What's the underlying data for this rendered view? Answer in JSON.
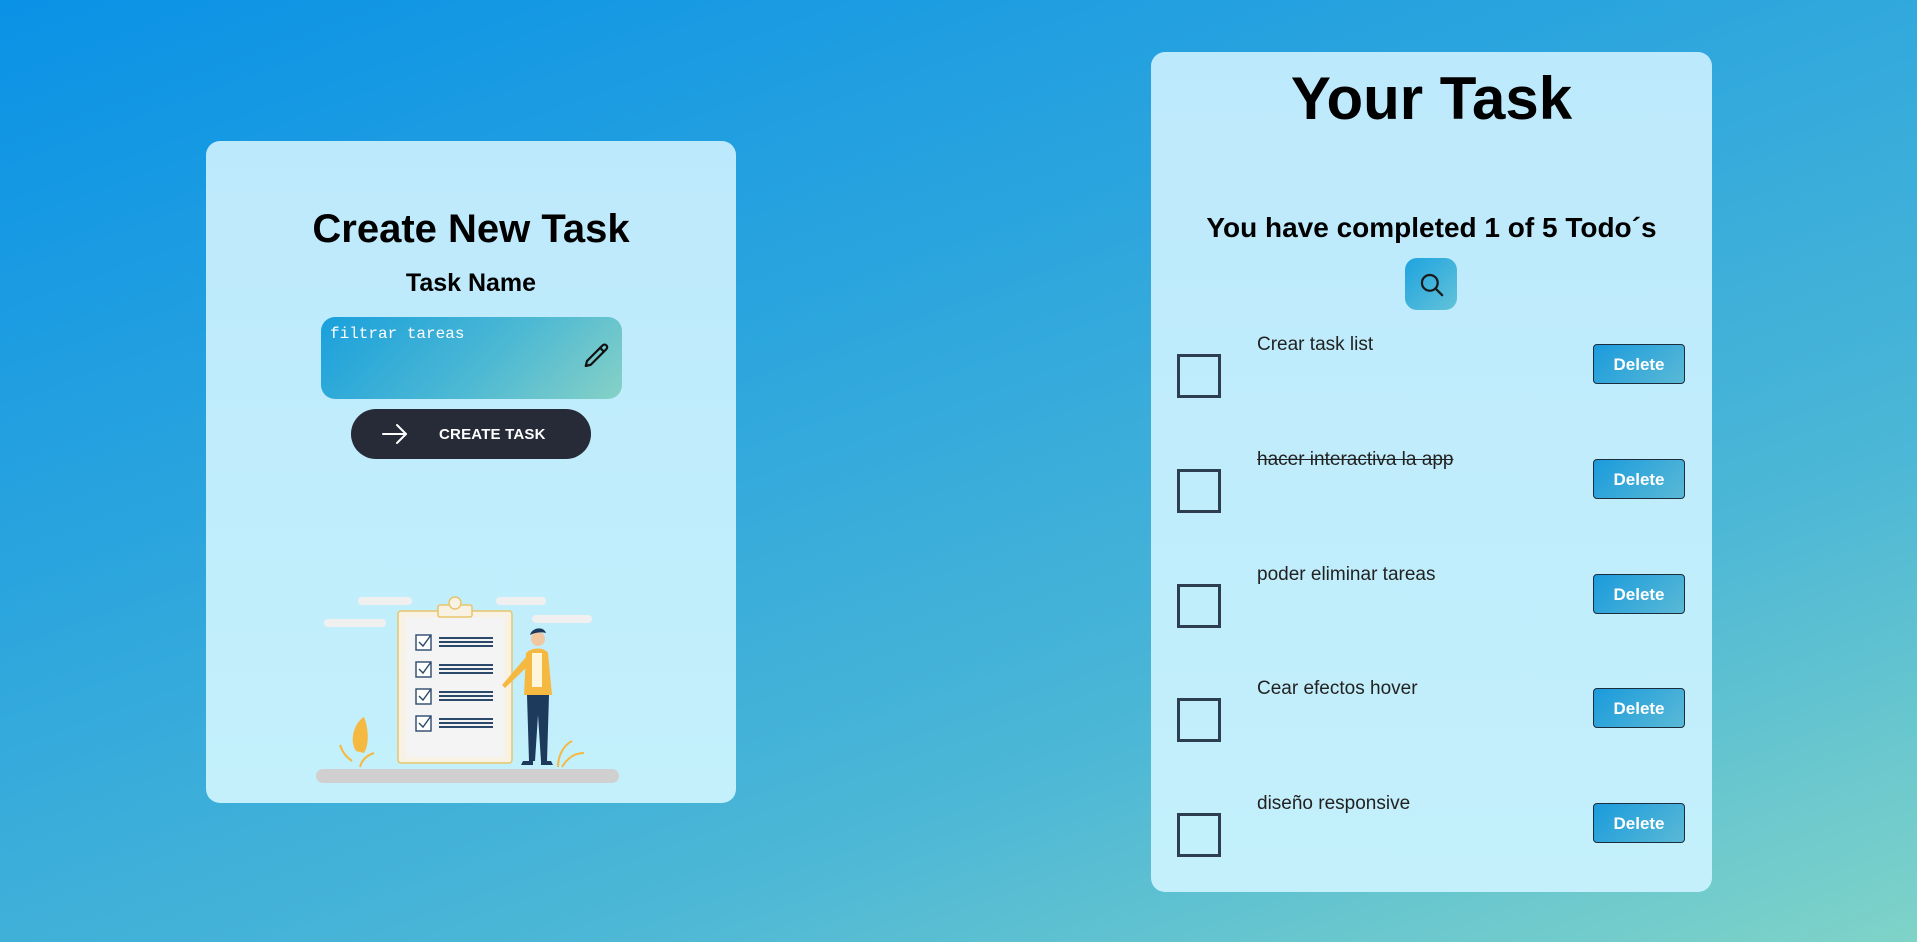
{
  "create_panel": {
    "title": "Create New Task",
    "label": "Task Name",
    "input_value": "filtrar tareas",
    "button_label": "CREATE TASK",
    "input_icon": "pencil-icon",
    "button_icon": "arrow-right-icon"
  },
  "list_panel": {
    "title": "Your Task",
    "completed_text": "You have completed 1 of 5 Todo´s",
    "search_icon": "search-icon",
    "todos": [
      {
        "text": "Crear task list",
        "done": false,
        "delete_label": "Delete"
      },
      {
        "text": "hacer interactiva la app",
        "done": true,
        "delete_label": "Delete"
      },
      {
        "text": "poder eliminar tareas",
        "done": false,
        "delete_label": "Delete"
      },
      {
        "text": "Cear efectos hover",
        "done": false,
        "delete_label": "Delete"
      },
      {
        "text": "diseño responsive",
        "done": false,
        "delete_label": "Delete"
      }
    ]
  },
  "colors": {
    "card_bg": "#bde9fc",
    "button_dark": "#272a37",
    "accent": "#1a9bdc",
    "checkbox_border": "#2c3e50"
  }
}
